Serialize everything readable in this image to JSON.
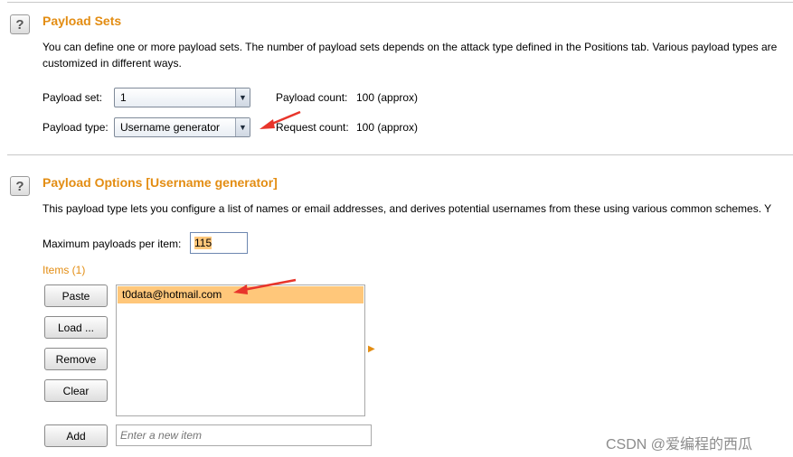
{
  "payload_sets": {
    "title": "Payload Sets",
    "description_line1": "You can define one or more payload sets. The number of payload sets depends on the attack type defined in the Positions tab. Various payload types are",
    "description_line2": "customized in different ways.",
    "payload_set_label": "Payload set:",
    "payload_set_value": "1",
    "payload_type_label": "Payload type:",
    "payload_type_value": "Username generator",
    "payload_count_label": "Payload count:",
    "payload_count_value": "100 (approx)",
    "request_count_label": "Request count:",
    "request_count_value": "100 (approx)"
  },
  "payload_options": {
    "title": "Payload Options [Username generator]",
    "description": "This payload type lets you configure a list of names or email addresses, and derives potential usernames from these using various common schemes. Y",
    "max_payloads_label": "Maximum payloads per item:",
    "max_payloads_value": "115",
    "items_label": "Items (1)",
    "items": [
      "t0data@hotmail.com"
    ],
    "buttons": {
      "paste": "Paste",
      "load": "Load ...",
      "remove": "Remove",
      "clear": "Clear",
      "add": "Add"
    },
    "new_item_placeholder": "Enter a new item"
  },
  "watermark": "CSDN @爱编程的西瓜",
  "icons": {
    "help": "?",
    "dropdown": "▼",
    "expand": "▶"
  },
  "colors": {
    "title": "#e38d13",
    "selection": "#ffc77a",
    "annotation_arrow": "#e8352b"
  }
}
